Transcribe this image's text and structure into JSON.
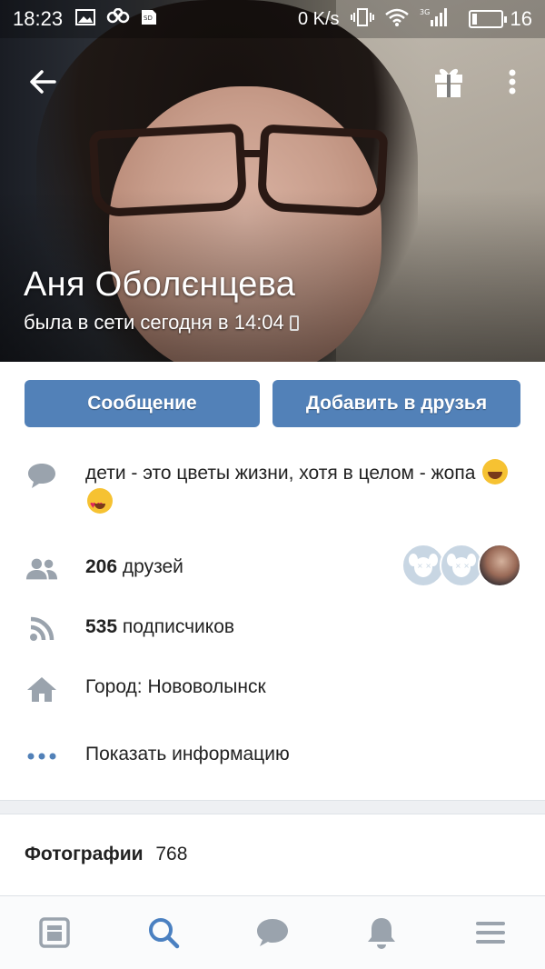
{
  "status_bar": {
    "time": "18:23",
    "network_speed": "0 K/s",
    "network_type": "3G",
    "battery_level": 16,
    "battery_text": "16"
  },
  "profile": {
    "name": "Аня Оболєнцева",
    "last_seen": "была в сети сегодня в 14:04"
  },
  "actions": {
    "message_label": "Сообщение",
    "add_friend_label": "Добавить в друзья"
  },
  "info": {
    "about": "дети - это цветы жизни, хотя в целом - жопа",
    "friends_count": "206",
    "friends_label": "друзей",
    "followers_count": "535",
    "followers_label": "подписчиков",
    "city": "Город: Нововолынск",
    "show_more": "Показать информацию"
  },
  "photos": {
    "label": "Фотографии",
    "count": "768"
  },
  "colors": {
    "accent": "#5281b8",
    "icon_gray": "#9aa3ad",
    "nav_active": "#4a80c1"
  }
}
